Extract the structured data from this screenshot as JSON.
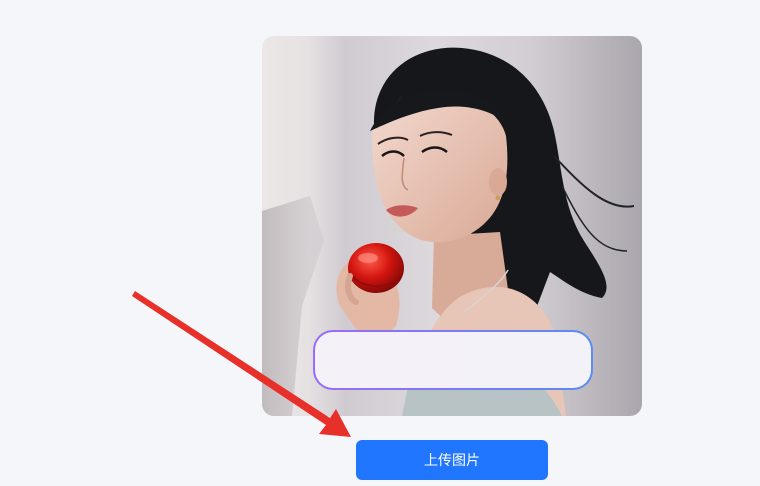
{
  "photo": {
    "subject": "woman-holding-red-jar-photo"
  },
  "caption": {
    "value": ""
  },
  "upload_button": {
    "label": "上传图片"
  },
  "annotation": {
    "arrow_color": "#e8302b"
  },
  "colors": {
    "page_background": "#f5f6f9",
    "button": "#2176ff",
    "caption_border_start": "#9a6cf6",
    "caption_border_end": "#5b8cf0"
  }
}
